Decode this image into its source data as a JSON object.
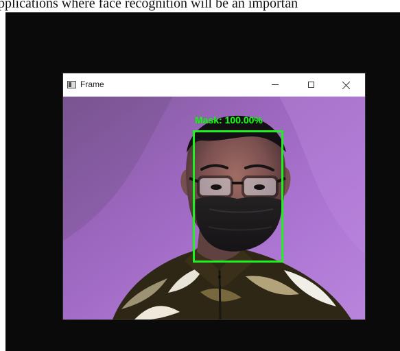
{
  "document": {
    "visible_text": "pplications where face recognition will be an importan"
  },
  "window": {
    "title": "Frame",
    "controls": {
      "minimize": "minimize-icon",
      "maximize": "maximize-icon",
      "close": "close-icon"
    }
  },
  "detection": {
    "label": "Mask: 100.00%",
    "status": "mask",
    "confidence_percent": 100.0,
    "box_color": "#20ef20"
  },
  "colors": {
    "desktop_background": "#0a0a0a",
    "window_background": "#ffffff",
    "wall": "#a36fce",
    "detection_green": "#20ef20",
    "mask": "#1f1c1d"
  }
}
